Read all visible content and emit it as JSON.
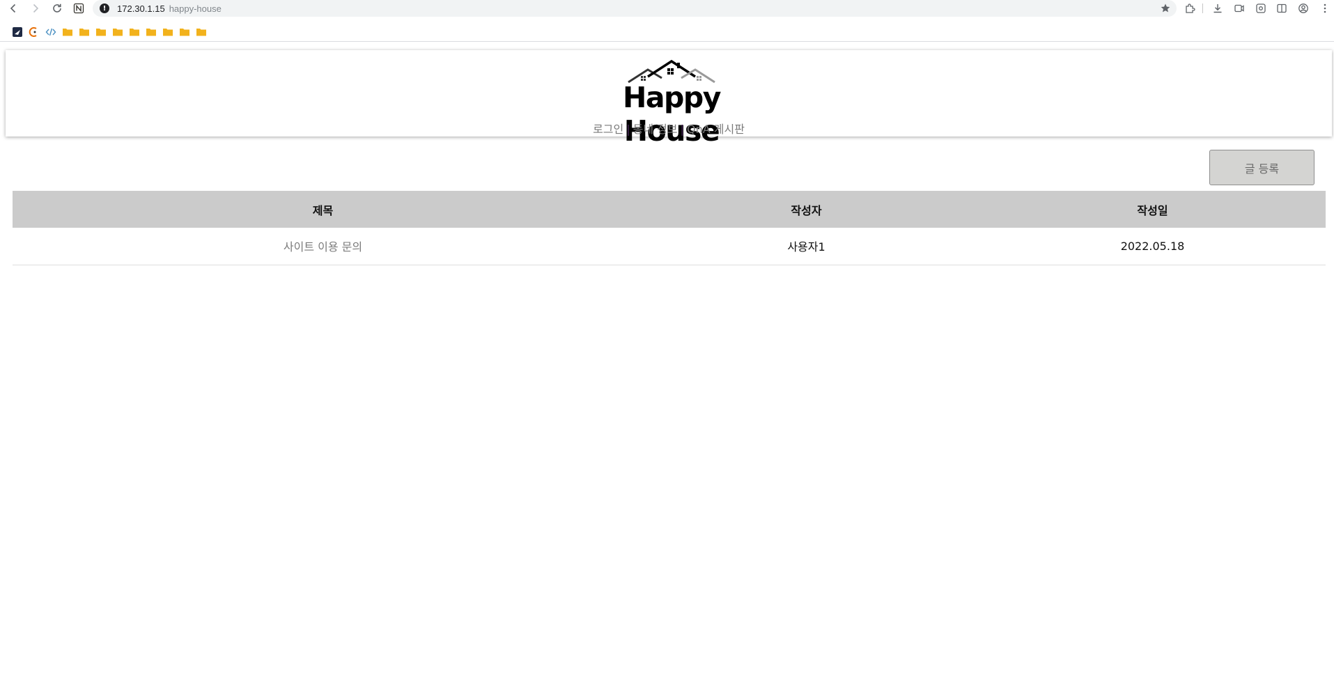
{
  "browser": {
    "url_host": "172.30.1.15",
    "url_path": "happy-house",
    "site_info_icon": "info-icon",
    "nav_icons": [
      "back-icon",
      "forward-icon",
      "reload-icon",
      "notion-icon"
    ],
    "toolbar_icons": [
      "bookmark-star-icon",
      "extensions-icon",
      "download-icon",
      "cast-icon",
      "screenshot-icon",
      "sidebar-icon",
      "profile-icon",
      "menu-icon"
    ],
    "bookmark_icons": [
      "app-bookmark-icon",
      "dev-bookmark-icon",
      "code-bookmark-icon",
      "folder-icon",
      "folder-icon",
      "folder-icon",
      "folder-icon",
      "folder-icon",
      "folder-icon",
      "folder-icon",
      "folder-icon",
      "folder-icon"
    ]
  },
  "header": {
    "logo_text": "Happy House",
    "nav": {
      "login": "로그인",
      "neighborhood": "동네 정보",
      "qna": "QnA 게시판",
      "separator": "|"
    }
  },
  "board": {
    "write_button_label": "글 등록",
    "columns": {
      "title": "제목",
      "author": "작성자",
      "date": "작성일"
    },
    "rows": [
      {
        "title": "사이트 이용 문의",
        "author": "사용자1",
        "date": "2022.05.18"
      }
    ]
  },
  "colors": {
    "folder": "#f2b21c",
    "table_header_bg": "#cbcbcb",
    "button_bg": "#d4d4d2",
    "link_gray": "#7a7a7a",
    "separator_purple": "#4b2a5e"
  }
}
